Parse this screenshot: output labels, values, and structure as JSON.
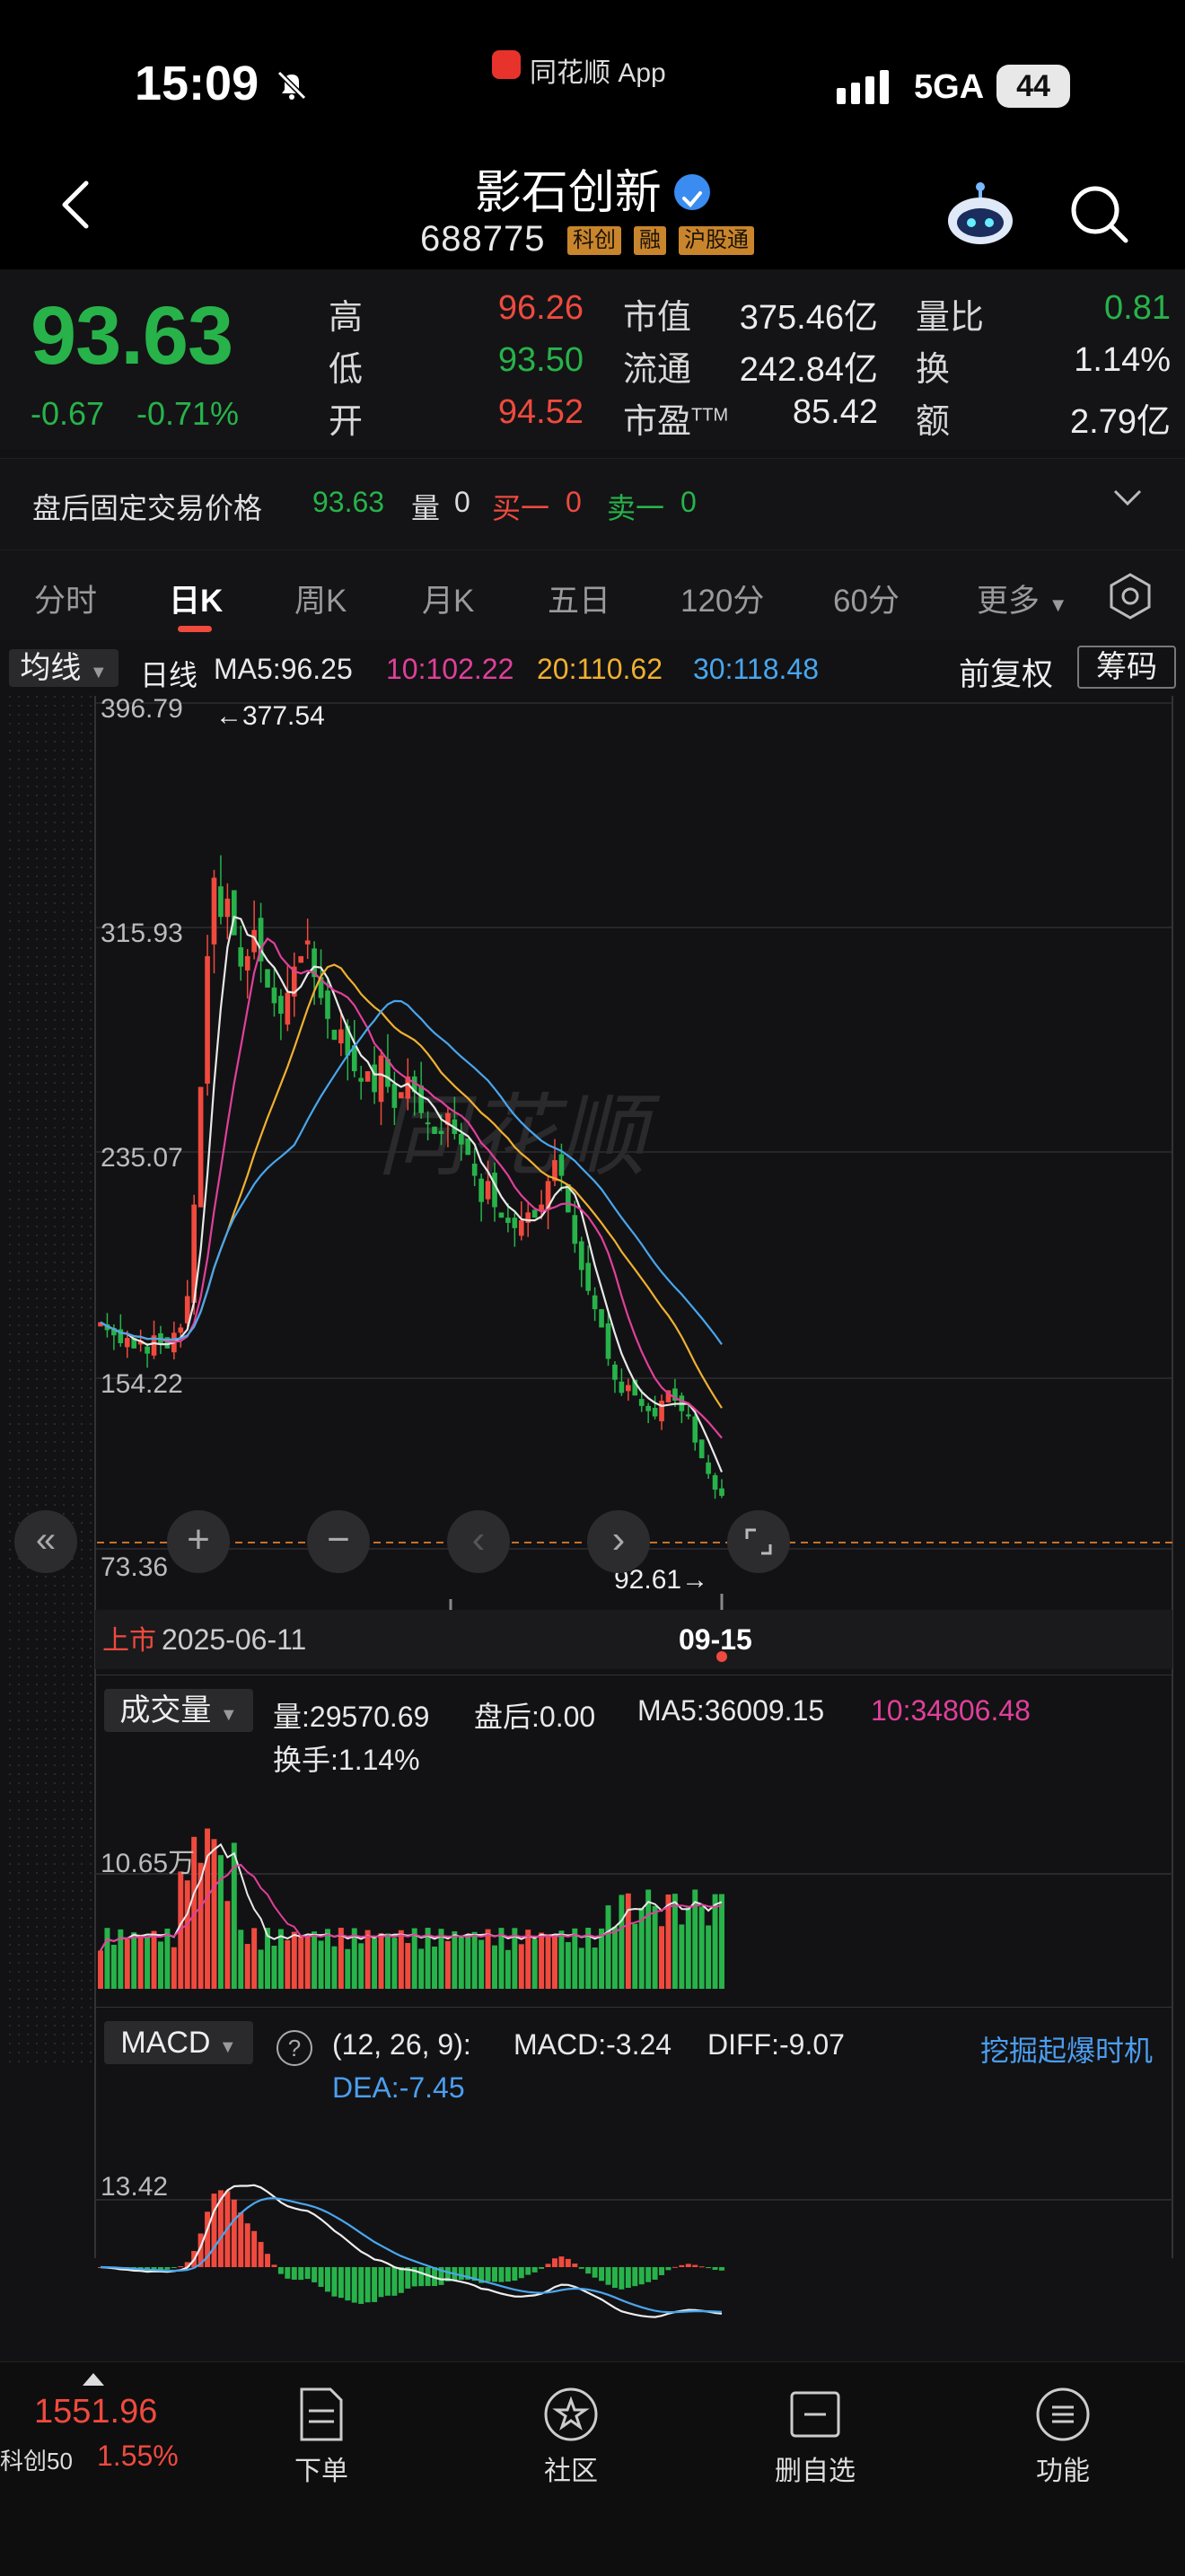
{
  "status_bar": {
    "time": "15:09",
    "source_app": "同花顺 App",
    "network": "5GA",
    "battery": "44"
  },
  "header": {
    "stock_name": "影石创新",
    "stock_code": "688775",
    "tags": [
      "科创",
      "融",
      "沪股通"
    ]
  },
  "quote": {
    "price": "93.63",
    "change": "-0.67",
    "change_pct": "-0.71%",
    "fields": [
      {
        "label": "高",
        "value": "96.26",
        "color": "#f04a3e"
      },
      {
        "label": "低",
        "value": "93.50",
        "color": "#27b34a"
      },
      {
        "label": "开",
        "value": "94.52",
        "color": "#f04a3e"
      },
      {
        "label": "市值",
        "value": "375.46亿",
        "color": "#ececec"
      },
      {
        "label": "流通",
        "value": "242.84亿",
        "color": "#ececec"
      },
      {
        "label": "市盈TTM",
        "value": "85.42",
        "color": "#ececec"
      },
      {
        "label": "量比",
        "value": "0.81",
        "color": "#27b34a"
      },
      {
        "label": "换",
        "value": "1.14%",
        "color": "#ececec"
      },
      {
        "label": "额",
        "value": "2.79亿",
        "color": "#ececec"
      }
    ]
  },
  "after_hours": {
    "label": "盘后固定交易价格",
    "price": "93.63",
    "vol_label": "量",
    "vol": "0",
    "buy_label": "买一",
    "buy": "0",
    "sell_label": "卖一",
    "sell": "0"
  },
  "tabs": [
    "分时",
    "日K",
    "周K",
    "月K",
    "五日",
    "120分",
    "60分",
    "更多"
  ],
  "active_tab": "日K",
  "kline": {
    "mode_select": "均线",
    "period_label": "日线",
    "ma": [
      {
        "label": "MA5:96.25",
        "color": "#e8e8e8"
      },
      {
        "label": "10:102.22",
        "color": "#e0409a"
      },
      {
        "label": "20:110.62",
        "color": "#f0b030"
      },
      {
        "label": "30:118.48",
        "color": "#49a6ee"
      }
    ],
    "adjust_label": "前复权",
    "chip_label": "筹码",
    "y_ticks": [
      "396.79",
      "315.93",
      "235.07",
      "154.22",
      "73.36"
    ],
    "high_marker": "←377.54",
    "low_marker": "92.61→",
    "list_label": "上市",
    "start_date": "2025-06-11",
    "end_date": "09-15",
    "watermark": "同花顺"
  },
  "volume": {
    "select_label": "成交量",
    "vol_text": "量:29570.69",
    "after_text": "盘后:0.00",
    "ma5_text": "MA5:36009.15",
    "ma10_text": "10:34806.48",
    "turnover_text": "换手:1.14%",
    "y_tick": "10.65万"
  },
  "macd": {
    "select_label": "MACD",
    "params": "(12, 26, 9):",
    "macd_text": "MACD:-3.24",
    "diff_text": "DIFF:-9.07",
    "dea_text": "DEA:-7.45",
    "promo": "挖掘起爆时机",
    "y_tick": "13.42"
  },
  "bottom_nav": {
    "index_value": "1551.96",
    "index_name": "科创50",
    "index_pct": "1.55%",
    "items": [
      "下单",
      "社区",
      "删自选",
      "功能"
    ]
  },
  "chart_data": {
    "type": "candlestick",
    "x_start": "2025-06-11",
    "x_end": "09-15",
    "ylim": [
      73.36,
      396.79
    ],
    "closes": [
      160,
      157,
      155,
      152,
      154,
      150,
      153,
      148,
      155,
      152,
      150,
      156,
      158,
      170,
      205,
      250,
      300,
      330,
      315,
      322,
      308,
      296,
      300,
      310,
      298,
      288,
      282,
      278,
      286,
      296,
      300,
      306,
      292,
      284,
      276,
      268,
      272,
      262,
      256,
      252,
      256,
      248,
      262,
      250,
      242,
      248,
      254,
      248,
      240,
      236,
      232,
      232,
      240,
      232,
      228,
      224,
      216,
      206,
      214,
      204,
      200,
      198,
      196,
      199,
      202,
      200,
      205,
      214,
      222,
      216,
      202,
      190,
      180,
      172,
      165,
      158,
      146,
      138,
      133,
      136,
      132,
      128,
      126,
      124,
      130,
      134,
      130,
      126,
      124,
      114,
      108,
      102,
      96,
      93.63
    ],
    "volume_max": "10.65万",
    "macd": {
      "macd": -3.24,
      "diff": -9.07,
      "dea": -7.45
    }
  }
}
